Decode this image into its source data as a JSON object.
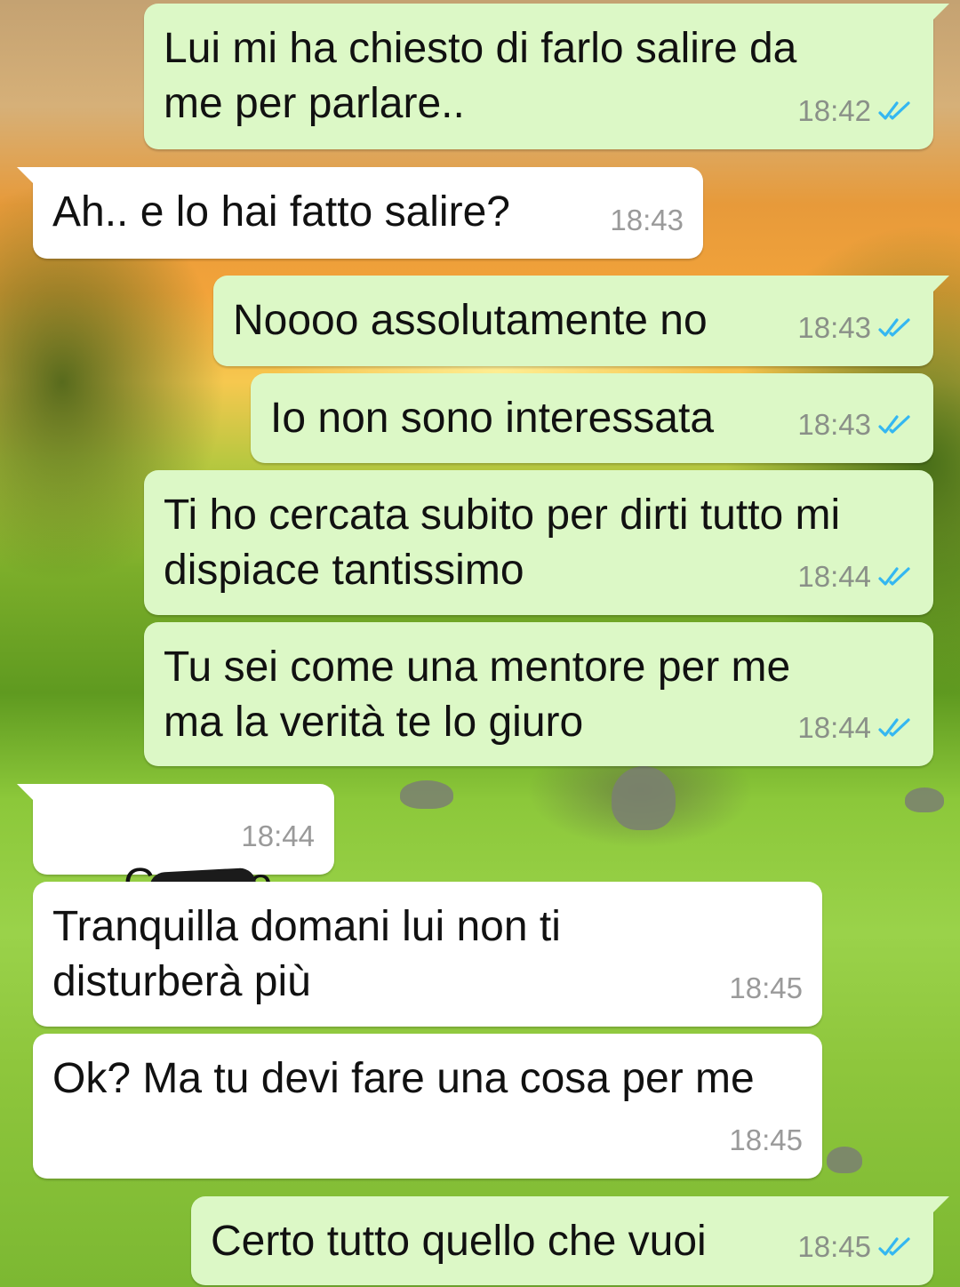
{
  "colors": {
    "outgoing_bubble": "#dcf8c6",
    "incoming_bubble": "#ffffff",
    "timestamp": "#8a9088",
    "read_ticks": "#34b7f1"
  },
  "icons": {
    "read_receipt": "double-check-icon"
  },
  "messages": [
    {
      "direction": "out",
      "text": "Lui mi ha chiesto di farlo salire da\nme per parlare..",
      "time": "18:42",
      "read": true
    },
    {
      "direction": "in",
      "text": "Ah.. e lo hai fatto salire?",
      "time": "18:43"
    },
    {
      "direction": "out",
      "text": "Noooo assolutamente no",
      "time": "18:43",
      "read": true
    },
    {
      "direction": "out",
      "text": "Io non sono interessata",
      "time": "18:43",
      "read": true
    },
    {
      "direction": "out",
      "text": "Ti ho cercata subito per dirti tutto mi\ndispiace tantissimo",
      "time": "18:44",
      "read": true
    },
    {
      "direction": "out",
      "text": "Tu sei come una mentore per me\nma la verità te lo giuro",
      "time": "18:44",
      "read": true
    },
    {
      "direction": "in",
      "text_start": "C",
      "text_redacted": true,
      "text_end": "o",
      "time": "18:44"
    },
    {
      "direction": "in",
      "text": "Tranquilla domani lui non ti\ndisturberà più",
      "time": "18:45"
    },
    {
      "direction": "in",
      "text": "Ok? Ma tu devi fare una cosa per me",
      "time": "18:45"
    },
    {
      "direction": "out",
      "text": "Certo tutto quello che vuoi",
      "time": "18:45",
      "read": true
    }
  ]
}
